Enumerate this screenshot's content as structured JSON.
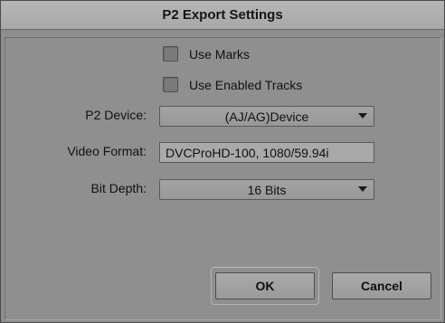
{
  "dialog": {
    "title": "P2 Export Settings"
  },
  "options": {
    "use_marks": {
      "label": "Use Marks",
      "checked": false
    },
    "use_enabled_tracks": {
      "label": "Use Enabled Tracks",
      "checked": false
    }
  },
  "fields": {
    "p2_device": {
      "label": "P2 Device:",
      "value": "(AJ/AG)Device"
    },
    "video_format": {
      "label": "Video Format:",
      "value": "DVCProHD-100, 1080/59.94i"
    },
    "bit_depth": {
      "label": "Bit Depth:",
      "value": "16 Bits"
    }
  },
  "buttons": {
    "ok": "OK",
    "cancel": "Cancel"
  }
}
